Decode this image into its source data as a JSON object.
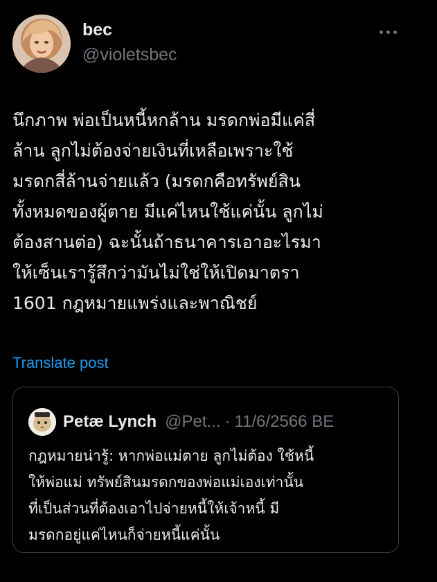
{
  "author": {
    "display_name": "bec",
    "handle": "@violetsbec",
    "avatar_icon": "profile-photo"
  },
  "more_icon": "more-horizontal-icon",
  "tweet": {
    "lines": [
      "นึกภาพ พ่อเป็นหนี้หกล้าน มรดกพ่อมีแค่สี่",
      "ล้าน ลูกไม่ต้องจ่ายเงินที่เหลือเพราะใช้",
      "มรดกสี่ล้านจ่ายแล้ว (มรดกคือทรัพย์สิน",
      "ทั้งหมดของผู้ตาย มีแค่ไหนใช้แค่นั้น ลูกไม่",
      "ต้องสานต่อ) ฉะนั้นถ้าธนาคารเอาอะไรมา",
      "ให้เซ็นเรารู้สึกว่ามันไม่ใช่ให้เปิดมาตรา",
      "1601 กฎหมายแพร่งและพาณิชย์"
    ]
  },
  "translate_label": "Translate post",
  "quote": {
    "display_name": "Petæ Lynch",
    "handle": "@Pet...",
    "separator": "·",
    "date": "11/6/2566 BE",
    "lines": [
      "กฎหมายน่ารู้: หากพ่อแม่ตาย ลูกไม่ต้อง ใช้หนี้",
      "ให้พ่อแม่ ทรัพย์สินมรดกของพ่อแม่เองเท่านั้น",
      "ที่เป็นส่วนที่ต้องเอาไปจ่ายหนี้ให้เจ้าหนี้ มี",
      "มรดกอยู่แค่ไหนก็จ่ายหนี้แค่นั้น"
    ]
  },
  "colors": {
    "background": "#000000",
    "text_primary": "#e7e9ea",
    "text_secondary": "#71767b",
    "link": "#1d9bf0",
    "border": "#3a3d41"
  }
}
